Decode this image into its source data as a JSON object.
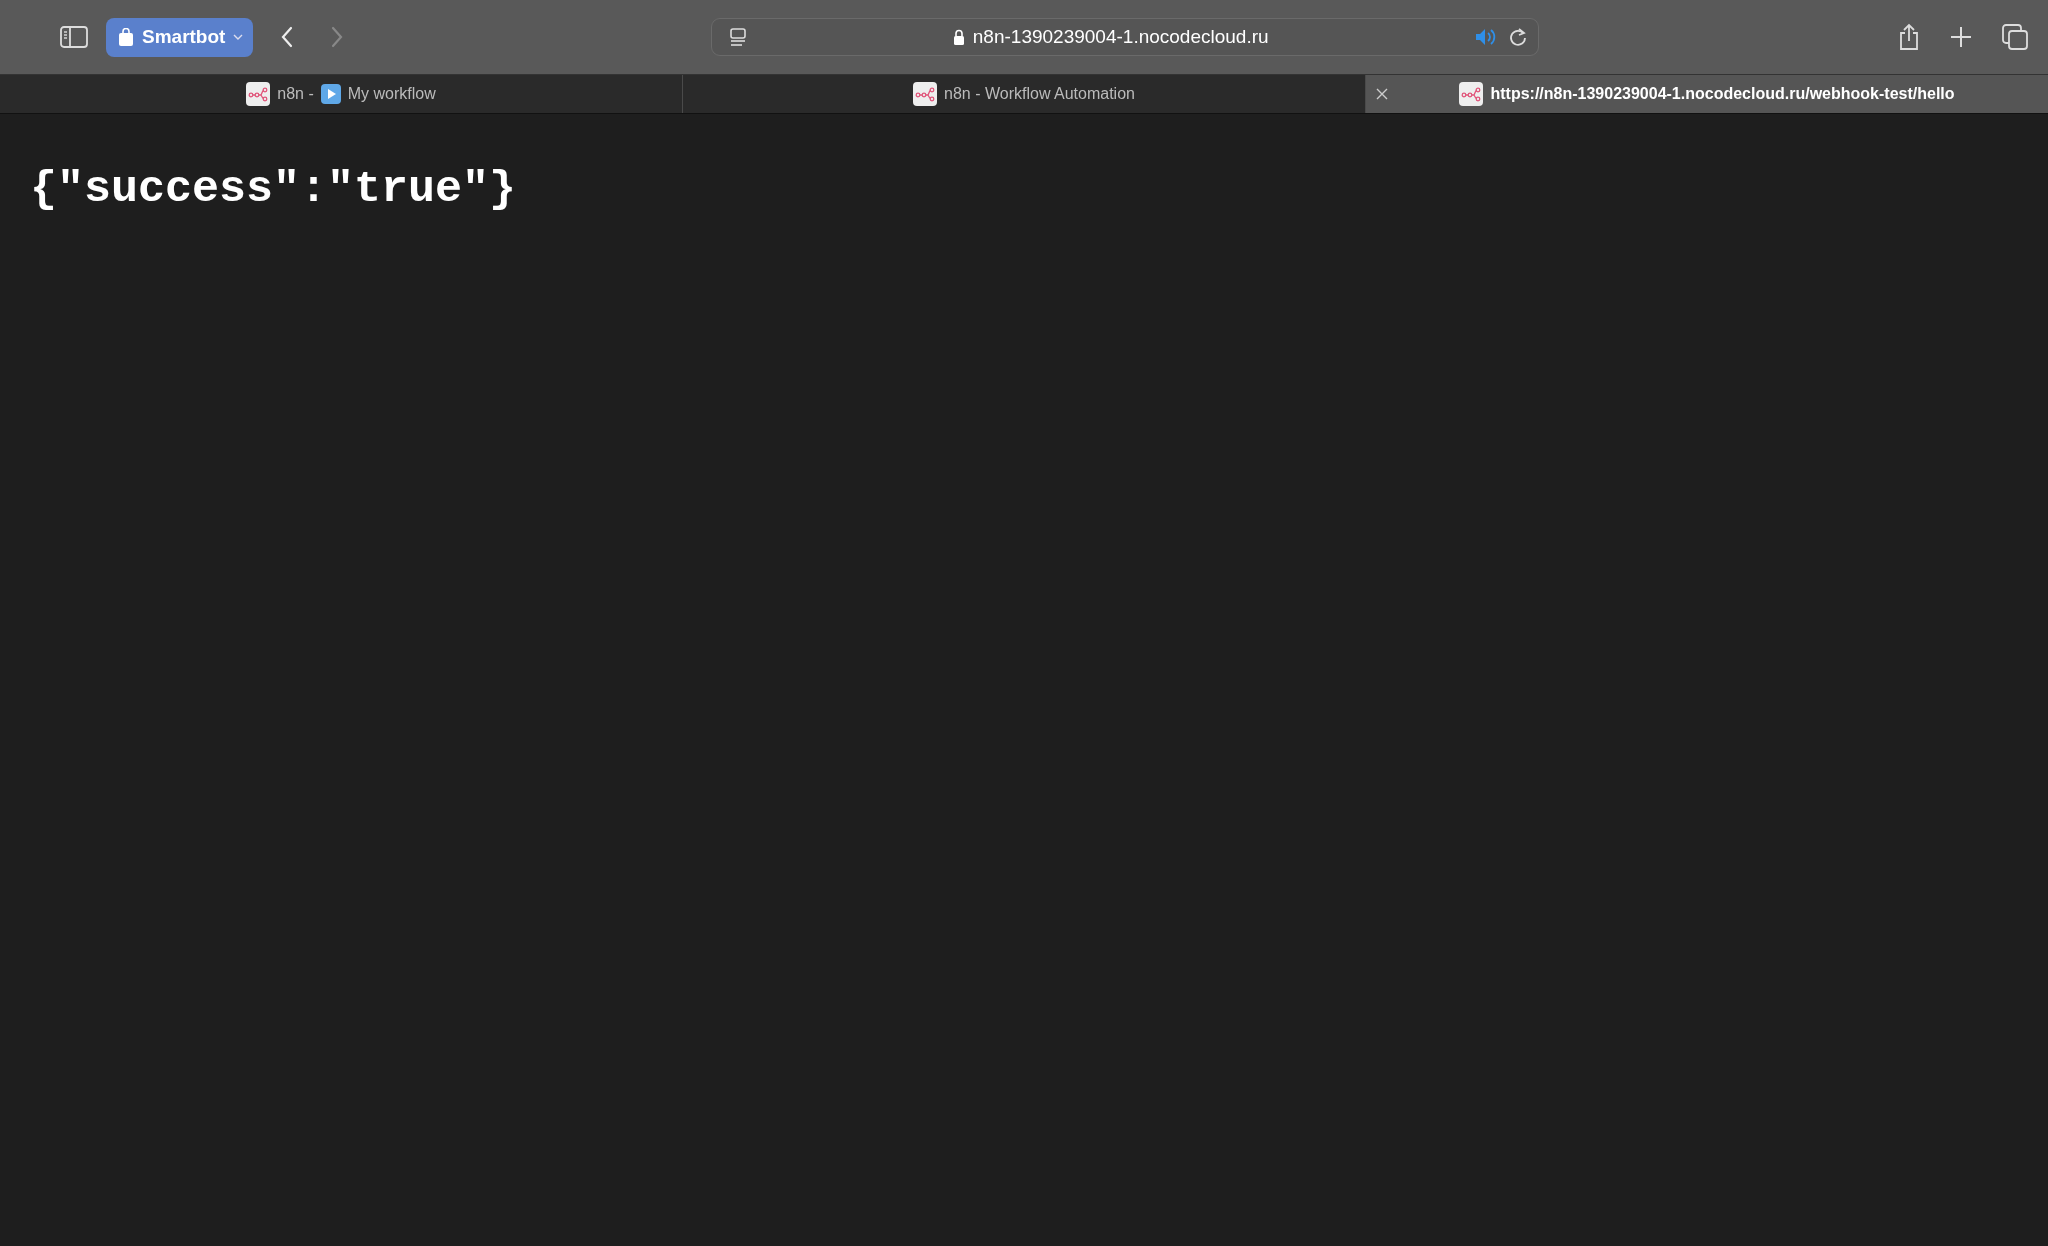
{
  "toolbar": {
    "profile": {
      "label": "Smartbot"
    },
    "back_enabled": true,
    "forward_enabled": false,
    "address": {
      "url": "n8n-1390239004-1.nocodecloud.ru"
    }
  },
  "tabs": [
    {
      "title": "n8n -",
      "title_after_icon": "My workflow",
      "selected": false,
      "closable": false
    },
    {
      "title": "n8n - Workflow Automation",
      "selected": false,
      "closable": false
    },
    {
      "title": "https://n8n-1390239004-1.nocodecloud.ru/webhook-test/hello",
      "selected": true,
      "closable": true
    }
  ],
  "page": {
    "body_text": "{\"success\":\"true\"}"
  }
}
